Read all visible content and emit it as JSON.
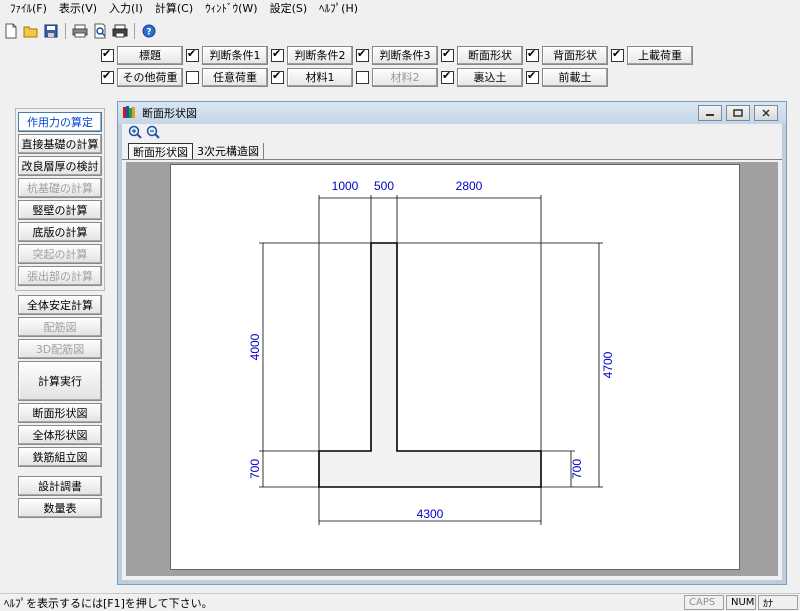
{
  "menu": [
    "ﾌｧｲﾙ(F)",
    "表示(V)",
    "入力(I)",
    "計算(C)",
    "ｳｨﾝﾄﾞｳ(W)",
    "設定(S)",
    "ﾍﾙﾌﾟ(H)"
  ],
  "toolbar_icons": [
    "new-file-icon",
    "open-folder-icon",
    "save-icon",
    "print-icon",
    "print-preview-icon",
    "printer-icon",
    "help-icon"
  ],
  "options_row1": [
    {
      "label": "標題",
      "checked": true,
      "enabled": true
    },
    {
      "label": "判断条件1",
      "checked": true,
      "enabled": true
    },
    {
      "label": "判断条件2",
      "checked": true,
      "enabled": true
    },
    {
      "label": "判断条件3",
      "checked": true,
      "enabled": true
    },
    {
      "label": "断面形状",
      "checked": true,
      "enabled": true
    },
    {
      "label": "背面形状",
      "checked": true,
      "enabled": true
    },
    {
      "label": "上載荷重",
      "checked": true,
      "enabled": true
    }
  ],
  "options_row2": [
    {
      "label": "その他荷重",
      "checked": true,
      "enabled": true
    },
    {
      "label": "任意荷重",
      "checked": false,
      "enabled": true
    },
    {
      "label": "材料1",
      "checked": true,
      "enabled": true
    },
    {
      "label": "材料2",
      "checked": false,
      "enabled": false
    },
    {
      "label": "裏込土",
      "checked": true,
      "enabled": true
    },
    {
      "label": "前載土",
      "checked": true,
      "enabled": true
    }
  ],
  "left_group1": [
    {
      "label": "作用力の算定",
      "state": "active"
    },
    {
      "label": "直接基礎の計算",
      "state": "enabled"
    },
    {
      "label": "改良層厚の検討",
      "state": "enabled"
    },
    {
      "label": "杭基礎の計算",
      "state": "disabled"
    },
    {
      "label": "竪壁の計算",
      "state": "enabled"
    },
    {
      "label": "底版の計算",
      "state": "enabled"
    },
    {
      "label": "突起の計算",
      "state": "disabled"
    },
    {
      "label": "張出部の計算",
      "state": "disabled"
    }
  ],
  "left_group2": [
    {
      "label": "全体安定計算",
      "state": "enabled"
    },
    {
      "label": "配筋図",
      "state": "disabled"
    },
    {
      "label": "3D配筋図",
      "state": "disabled"
    },
    {
      "label": "計算実行",
      "state": "tall"
    },
    {
      "label": "断面形状図",
      "state": "enabled"
    },
    {
      "label": "全体形状図",
      "state": "enabled"
    },
    {
      "label": "鉄筋組立図",
      "state": "enabled"
    }
  ],
  "left_group3": [
    {
      "label": "設計調書",
      "state": "enabled"
    },
    {
      "label": "数量表",
      "state": "enabled"
    }
  ],
  "child_window": {
    "title": "断面形状図",
    "tabs": [
      {
        "label": "断面形状図",
        "active": true
      },
      {
        "label": "3次元構造図",
        "active": false
      }
    ]
  },
  "drawing": {
    "dim_color": "#0000cc",
    "dims_top": [
      "1000",
      "500",
      "2800"
    ],
    "dim_bottom": "4300",
    "dim_left_wall": "4000",
    "dim_left_base": "700",
    "dim_right_total": "4700",
    "dim_right_base": "700"
  },
  "status": {
    "message": "ﾍﾙﾌﾟを表示するには[F1]を押して下さい。",
    "caps": "CAPS",
    "num": "NUM",
    "kana": "ｶﾅ"
  }
}
